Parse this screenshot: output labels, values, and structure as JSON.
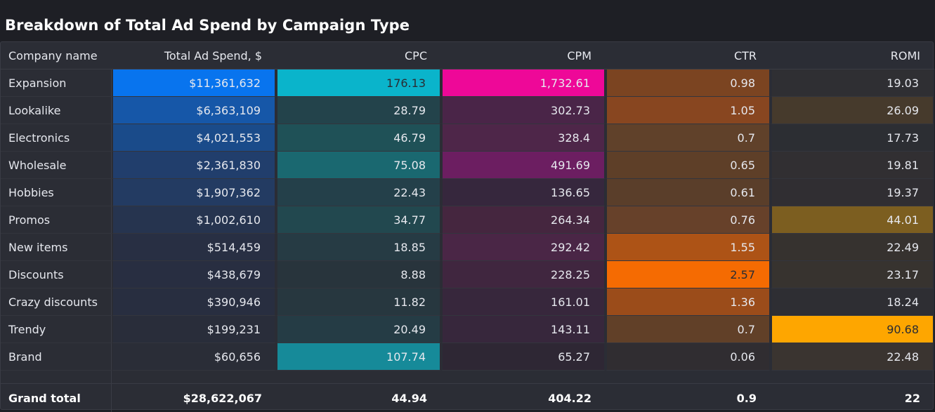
{
  "title": "Breakdown of Total Ad Spend by Campaign Type",
  "columns": [
    "Company name",
    "Total Ad Spend, $",
    "CPC",
    "CPM",
    "CTR",
    "ROMI"
  ],
  "rows": [
    {
      "name": "Expansion",
      "spend": "$11,361,632",
      "cpc": "176.13",
      "cpm": "1,732.61",
      "ctr": "0.98",
      "romi": "19.03"
    },
    {
      "name": "Lookalike",
      "spend": "$6,363,109",
      "cpc": "28.79",
      "cpm": "302.73",
      "ctr": "1.05",
      "romi": "26.09"
    },
    {
      "name": "Electronics",
      "spend": "$4,021,553",
      "cpc": "46.79",
      "cpm": "328.4",
      "ctr": "0.7",
      "romi": "17.73"
    },
    {
      "name": "Wholesale",
      "spend": "$2,361,830",
      "cpc": "75.08",
      "cpm": "491.69",
      "ctr": "0.65",
      "romi": "19.81"
    },
    {
      "name": "Hobbies",
      "spend": "$1,907,362",
      "cpc": "22.43",
      "cpm": "136.65",
      "ctr": "0.61",
      "romi": "19.37"
    },
    {
      "name": "Promos",
      "spend": "$1,002,610",
      "cpc": "34.77",
      "cpm": "264.34",
      "ctr": "0.76",
      "romi": "44.01"
    },
    {
      "name": "New items",
      "spend": "$514,459",
      "cpc": "18.85",
      "cpm": "292.42",
      "ctr": "1.55",
      "romi": "22.49"
    },
    {
      "name": "Discounts",
      "spend": "$438,679",
      "cpc": "8.88",
      "cpm": "228.25",
      "ctr": "2.57",
      "romi": "23.17"
    },
    {
      "name": "Crazy discounts",
      "spend": "$390,946",
      "cpc": "11.82",
      "cpm": "161.01",
      "ctr": "1.36",
      "romi": "18.24"
    },
    {
      "name": "Trendy",
      "spend": "$199,231",
      "cpc": "20.49",
      "cpm": "143.11",
      "ctr": "0.7",
      "romi": "90.68"
    },
    {
      "name": "Brand",
      "spend": "$60,656",
      "cpc": "107.74",
      "cpm": "65.27",
      "ctr": "0.06",
      "romi": "22.48"
    }
  ],
  "total": {
    "name": "Grand total",
    "spend": "$28,622,067",
    "cpc": "44.94",
    "cpm": "404.22",
    "ctr": "0.9",
    "romi": "22"
  },
  "heat_colors": {
    "spend": [
      "#0874ee",
      "#1657a8",
      "#1a4b8a",
      "#213e6c",
      "#233b62",
      "#26344f",
      "#282f43",
      "#282e41",
      "#282e40",
      "#292d3a",
      "#2a2d37"
    ],
    "cpc": [
      "#0ab4cb",
      "#23434b",
      "#1f5157",
      "#1a6870",
      "#24404a",
      "#22484f",
      "#263b44",
      "#28343c",
      "#27373f",
      "#253c45",
      "#168a99"
    ],
    "cpm": [
      "#ee0898",
      "#4a2548",
      "#4e2649",
      "#6c1e61",
      "#36273d",
      "#45263f",
      "#4a2646",
      "#40263f",
      "#37273c",
      "#37273c",
      "#2e2734"
    ],
    "ctr": [
      "#7b4421",
      "#884620",
      "#60412a",
      "#5e3f28",
      "#5a3e2a",
      "#67412a",
      "#ad5316",
      "#f56b02",
      "#9b4c1a",
      "#614028",
      "#302d31"
    ],
    "romi": [
      "#2f2f33",
      "#463a2c",
      "#2c2e33",
      "#312f32",
      "#302e32",
      "#7c5e20",
      "#36322f",
      "#37332f",
      "#2e2e33",
      "#fea600",
      "#3a3430"
    ]
  },
  "dark_text_cells": [
    {
      "row": 0,
      "col": "cpc"
    },
    {
      "row": 7,
      "col": "ctr"
    },
    {
      "row": 9,
      "col": "romi"
    }
  ]
}
